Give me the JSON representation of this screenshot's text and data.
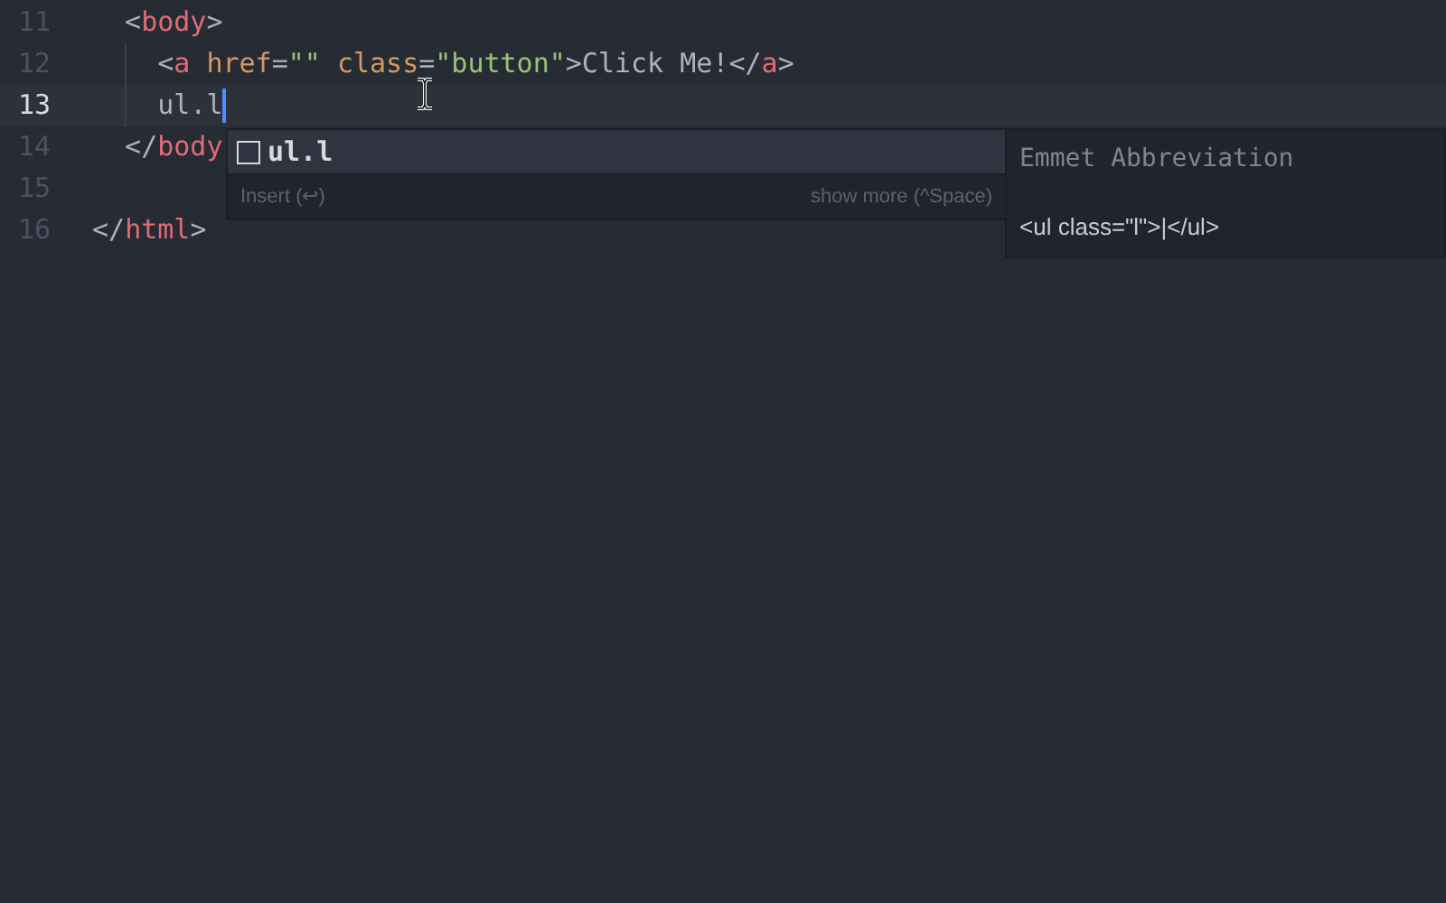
{
  "editor": {
    "lines": [
      {
        "number": "11",
        "current": false,
        "tokens": [
          {
            "kind": "punct",
            "text": "  <"
          },
          {
            "kind": "tag",
            "text": "body"
          },
          {
            "kind": "punct",
            "text": ">"
          }
        ]
      },
      {
        "number": "12",
        "current": false,
        "tokens": [
          {
            "kind": "punct",
            "text": "    <"
          },
          {
            "kind": "tag",
            "text": "a"
          },
          {
            "kind": "attr",
            "text": " href"
          },
          {
            "kind": "punct",
            "text": "="
          },
          {
            "kind": "string",
            "text": "\"\""
          },
          {
            "kind": "attr",
            "text": " class"
          },
          {
            "kind": "punct",
            "text": "="
          },
          {
            "kind": "string",
            "text": "\"button\""
          },
          {
            "kind": "punct",
            "text": ">Click Me!</"
          },
          {
            "kind": "tag",
            "text": "a"
          },
          {
            "kind": "punct",
            "text": ">"
          }
        ]
      },
      {
        "number": "13",
        "current": true,
        "tokens": [
          {
            "kind": "plain",
            "text": "    ul.l"
          }
        ]
      },
      {
        "number": "14",
        "current": false,
        "tokens": [
          {
            "kind": "punct",
            "text": "  </"
          },
          {
            "kind": "tag",
            "text": "body"
          }
        ]
      },
      {
        "number": "15",
        "current": false
      },
      {
        "number": "16",
        "current": false,
        "tokens": [
          {
            "kind": "punct",
            "text": "</"
          },
          {
            "kind": "tag",
            "text": "html"
          },
          {
            "kind": "punct",
            "text": ">"
          }
        ]
      }
    ]
  },
  "autocomplete": {
    "suggestions": [
      {
        "text": "ul.l",
        "selected": true
      }
    ],
    "footer_left": "Insert (↩)",
    "footer_right": "show more (^Space)"
  },
  "details": {
    "title": "Emmet Abbreviation",
    "preview": "<ul class=\"l\">|</ul>"
  }
}
